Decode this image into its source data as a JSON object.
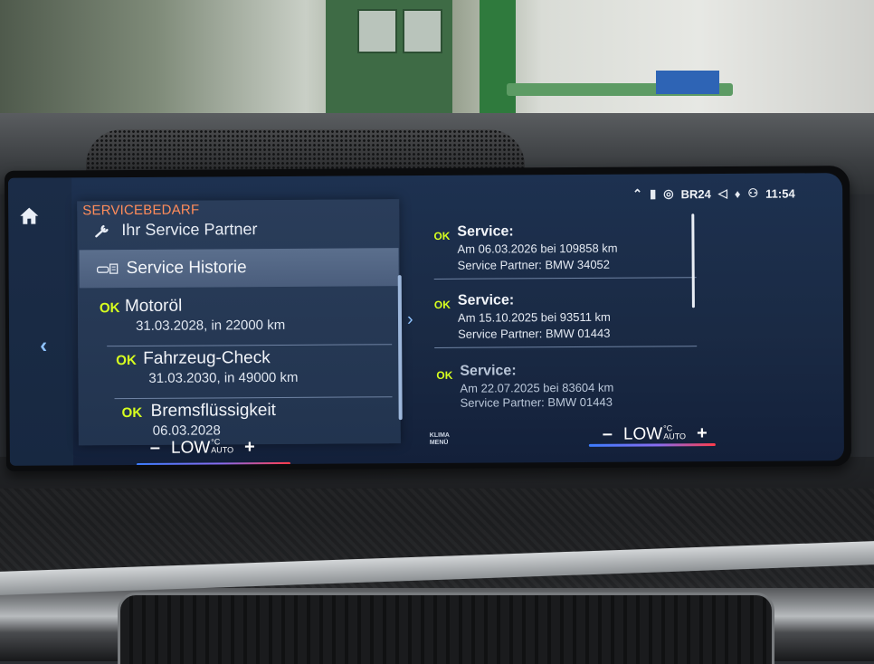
{
  "status_bar": {
    "notification_icon": "chevron-up-icon",
    "station": "BR24",
    "time": "11:54"
  },
  "left_panel": {
    "title": "SERVICEBEDARF",
    "partner_label": "Ihr Service Partner",
    "history_label": "Service Historie",
    "items": [
      {
        "badge": "OK",
        "name": "Motoröl",
        "detail": "31.03.2028, in 22000 km"
      },
      {
        "badge": "OK",
        "name": "Fahrzeug-Check",
        "detail": "31.03.2030, in 49000 km"
      },
      {
        "badge": "OK",
        "name": "Bremsflüssigkeit",
        "detail": "06.03.2028"
      }
    ]
  },
  "history": [
    {
      "badge": "OK",
      "title": "Service:",
      "date_line": "Am 06.03.2026 bei 109858 km",
      "partner_line": "Service Partner: BMW 34052"
    },
    {
      "badge": "OK",
      "title": "Service:",
      "date_line": "Am 15.10.2025 bei 93511 km",
      "partner_line": "Service Partner: BMW 01443"
    },
    {
      "badge": "OK",
      "title": "Service:",
      "date_line": "Am 22.07.2025 bei 83604 km",
      "partner_line": "Service Partner: BMW 01443"
    }
  ],
  "climate": {
    "left": {
      "minus": "–",
      "temp": "LOW",
      "unit": "°C",
      "mode": "AUTO",
      "plus": "+"
    },
    "right": {
      "minus": "–",
      "temp": "LOW",
      "unit": "°C",
      "mode": "AUTO",
      "plus": "+"
    },
    "menu_line1": "KLIMA",
    "menu_line2": "MENÜ"
  },
  "colors": {
    "ok_badge": "#d7ff1f",
    "title_accent": "#ff8c5a",
    "selected_row": "#4a5d7c"
  }
}
